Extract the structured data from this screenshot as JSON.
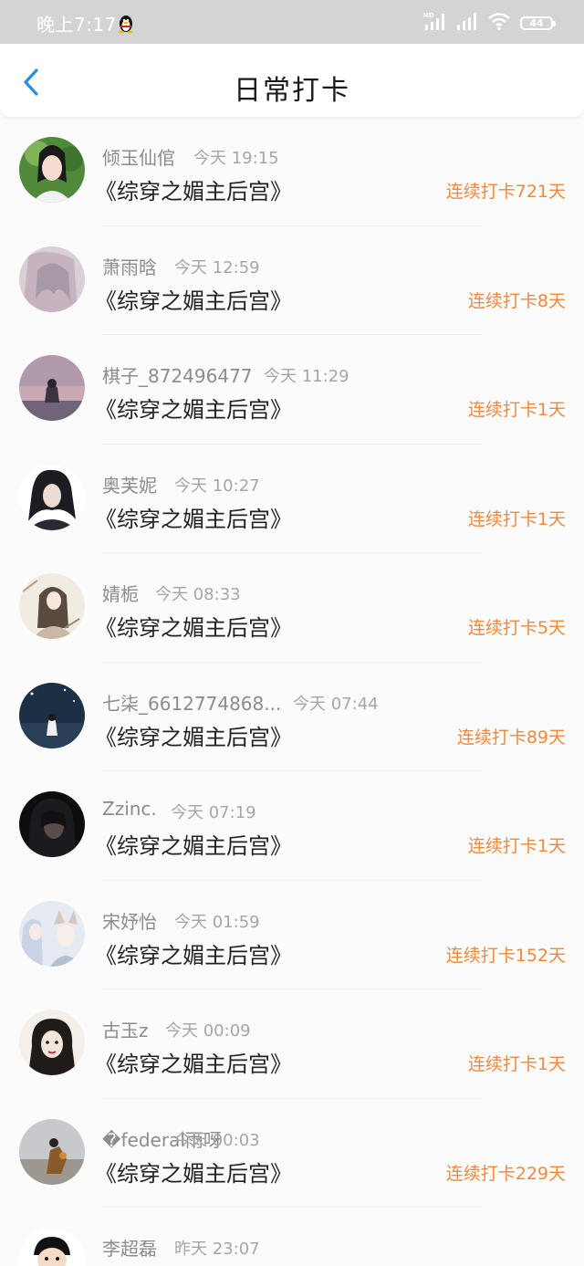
{
  "status_bar": {
    "time": "晚上7:17",
    "hd_label": "HD",
    "battery": "44"
  },
  "header": {
    "title": "日常打卡",
    "back_icon": "chevron-left-icon"
  },
  "accent_color": "#f0893c",
  "entries": [
    {
      "name": "倾玉仙倌",
      "time": "今天 19:15",
      "book": "《综穿之媚主后宫》",
      "streak": "连续打卡721天"
    },
    {
      "name": "萧雨晗",
      "time": "今天 12:59",
      "book": "《综穿之媚主后宫》",
      "streak": "连续打卡8天"
    },
    {
      "name": "棋子_872496477",
      "time": "今天 11:29",
      "book": "《综穿之媚主后宫》",
      "streak": "连续打卡1天"
    },
    {
      "name": "奥芙妮",
      "time": "今天 10:27",
      "book": "《综穿之媚主后宫》",
      "streak": "连续打卡1天"
    },
    {
      "name": "婧栀",
      "time": "今天 08:33",
      "book": "《综穿之媚主后宫》",
      "streak": "连续打卡5天"
    },
    {
      "name": "七柒_6612774868...",
      "time": "今天 07:44",
      "book": "《综穿之媚主后宫》",
      "streak": "连续打卡89天"
    },
    {
      "name": "Zzinc.",
      "time": "今天 07:19",
      "book": "《综穿之媚主后宫》",
      "streak": "连续打卡1天"
    },
    {
      "name": "宋妤怡",
      "time": "今天 01:59",
      "book": "《综穿之媚主后宫》",
      "streak": "连续打卡152天"
    },
    {
      "name": "古玉z",
      "time": "今天 00:09",
      "book": "《综穿之媚主后宫》",
      "streak": "连续打卡1天"
    },
    {
      "name": "�federal雨呀",
      "time": "今天 00:03",
      "book": "《综穿之媚主后宫》",
      "streak": "连续打卡229天"
    },
    {
      "name": "李超磊",
      "time": "昨天 23:07",
      "book": "",
      "streak": ""
    }
  ]
}
